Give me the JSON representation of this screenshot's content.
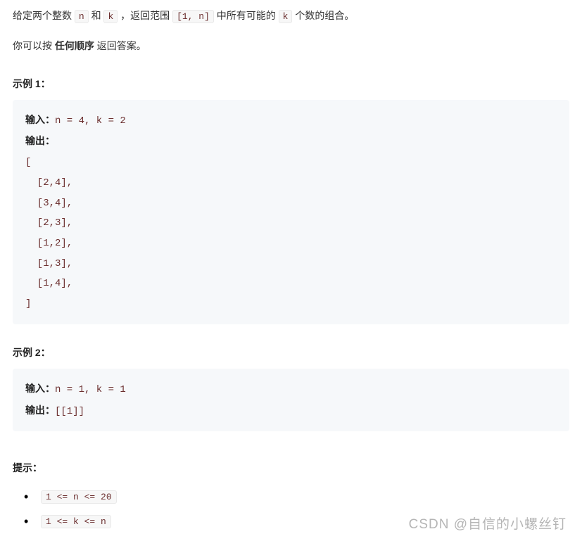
{
  "intro": {
    "p1_part1": "给定两个整数 ",
    "p1_code1": "n",
    "p1_part2": " 和 ",
    "p1_code2": "k",
    "p1_part3": " ，返回范围 ",
    "p1_code3": "[1, n]",
    "p1_part4": " 中所有可能的 ",
    "p1_code4": "k",
    "p1_part5": " 个数的组合。",
    "p2_part1": "你可以按 ",
    "p2_bold": "任何顺序",
    "p2_part2": " 返回答案。"
  },
  "example1": {
    "title": "示例 1：",
    "input_label": "输入：",
    "input_value": "n = 4, k = 2",
    "output_label": "输出：",
    "output_value": "\n[\n  [2,4],\n  [3,4],\n  [2,3],\n  [1,2],\n  [1,3],\n  [1,4],\n]"
  },
  "example2": {
    "title": "示例 2：",
    "input_label": "输入：",
    "input_value": "n = 1, k = 1",
    "output_label": "输出：",
    "output_value": "[[1]]"
  },
  "hints": {
    "title": "提示：",
    "items": [
      "1 <= n <= 20",
      "1 <= k <= n"
    ]
  },
  "watermark": "CSDN @自信的小螺丝钉"
}
